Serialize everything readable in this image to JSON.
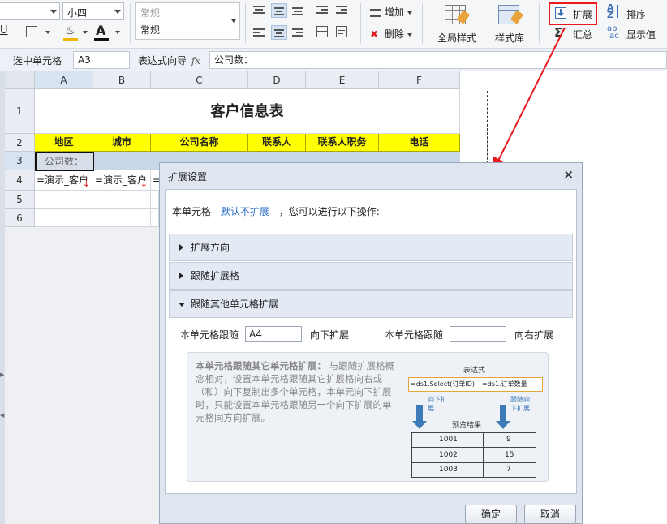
{
  "ribbon": {
    "font_size_value": "小四",
    "number_format_placeholder": "常规",
    "number_format_value": "常规",
    "underline_label": "U",
    "add_label": "增加",
    "delete_label": "删除",
    "global_style_label": "全局样式",
    "style_library_label": "样式库",
    "expand_label": "扩展",
    "summary_label": "汇总",
    "sort_label": "排序",
    "display_value_label": "显示值"
  },
  "formula_bar": {
    "selected_cell_label": "选中单元格",
    "cell_ref": "A3",
    "expr_wizard_label": "表达式向导",
    "fx_label": "fx",
    "formula_value": "公司数："
  },
  "sheet": {
    "columns": [
      "A",
      "B",
      "C",
      "D",
      "E",
      "F"
    ],
    "rows": [
      "1",
      "2",
      "3",
      "4",
      "5",
      "6"
    ],
    "title": "客户信息表",
    "headers": [
      "地区",
      "城市",
      "公司名称",
      "联系人",
      "联系人职务",
      "电话"
    ],
    "row3_a": "公司数：",
    "row4_a": "=演示_客户",
    "row4_b": "=演示_客户",
    "row4_c": "="
  },
  "dialog": {
    "title": "扩展设置",
    "close_label": "×",
    "intro_prefix": "本单元格",
    "intro_link": "默认不扩展",
    "intro_suffix": "，您可以进行以下操作:",
    "section1": "扩展方向",
    "section2": "跟随扩展格",
    "section3": "跟随其他单元格扩展",
    "follow_label1": "本单元格跟随",
    "follow_value1": "A4",
    "down_label": "向下扩展",
    "follow_label2": "本单元格跟随",
    "follow_value2": "",
    "right_label": "向右扩展",
    "hint_title": "本单元格跟随其它单元格扩展：",
    "hint_body": "与跟随扩展格概念相对，设置本单元格跟随其它扩展格向右或（和）向下复制出多个单元格，本单元向下扩展时，只能设置本单元格跟随另一个向下扩展的单元格同方向扩展。",
    "diagram": {
      "expr_title": "表达式",
      "expr_left": "=ds1.Select(订单ID)",
      "expr_right": "=ds1.订单数量",
      "down_left": "向下扩展",
      "follow_right": "跟随向下扩展",
      "preview_label": "预览结果",
      "rows": [
        [
          "1001",
          "9"
        ],
        [
          "1002",
          "15"
        ],
        [
          "1003",
          "7"
        ]
      ]
    },
    "ok_label": "确定",
    "cancel_label": "取消"
  },
  "colors": {
    "header_yellow": "#ffff00",
    "highlight_red": "#e8191c",
    "link_blue": "#2a6fc9",
    "arrow_blue": "#3d7ab8"
  }
}
